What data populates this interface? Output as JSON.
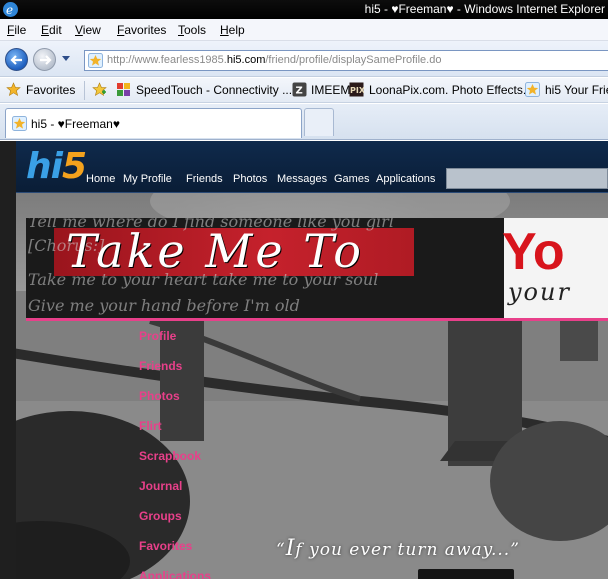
{
  "window": {
    "title": "hi5 - ♥Freeman♥ - Windows Internet Explorer"
  },
  "menu": [
    {
      "key": "F",
      "rest": "ile"
    },
    {
      "key": "E",
      "rest": "dit"
    },
    {
      "key": "V",
      "rest": "iew"
    },
    {
      "key": "F",
      "rest": "avorites",
      "prefix": ""
    },
    {
      "key": "T",
      "rest": "ools"
    },
    {
      "key": "H",
      "rest": "elp"
    }
  ],
  "address": {
    "url_prefix": "http://www.fearless1985.",
    "url_host": "hi5.com",
    "url_suffix": "/friend/profile/displaySameProfile.do"
  },
  "favorites_bar": {
    "favorites_label": "Favorites",
    "items": [
      {
        "label": "SpeedTouch - Connectivity ...",
        "icon": "speedtouch-icon"
      },
      {
        "label": "IMEEM",
        "icon": "imeem-icon"
      },
      {
        "label": "LoonaPix.com. Photo Effects...",
        "icon": "loonapix-icon"
      },
      {
        "label": "hi5  Your Frie",
        "icon": "hi5-favicon"
      }
    ]
  },
  "tabs": [
    {
      "label": "hi5 - ♥Freeman♥",
      "active": true
    }
  ],
  "hi5": {
    "logo_hi": "hi",
    "logo_five": "5",
    "nav": [
      "Home",
      "My Profile",
      "Friends",
      "Photos",
      "Messages",
      "Games",
      "Applications"
    ]
  },
  "banner": {
    "ghost_lines": [
      "Tell me where do I find someone like you girl",
      "[Chorus:]",
      "Take me to your heart take me to your soul",
      "Give me your hand before I'm old"
    ],
    "title": "Take Me To",
    "title_red": "Yo",
    "script_text": "your"
  },
  "sidebar_links": [
    "Profile",
    "Friends",
    "Photos",
    "Flirt",
    "Scrapbook",
    "Journal",
    "Groups",
    "Favorites",
    "Applications"
  ],
  "quote": {
    "open_mark": "“",
    "big_letter": "I",
    "text": "f you ever turn away...",
    "close_mark": "”"
  },
  "colors": {
    "hi5_blue": "#3aa0e6",
    "hi5_orange": "#f4a21d",
    "link_pink": "#e8408a",
    "banner_red": "#d8141c"
  }
}
